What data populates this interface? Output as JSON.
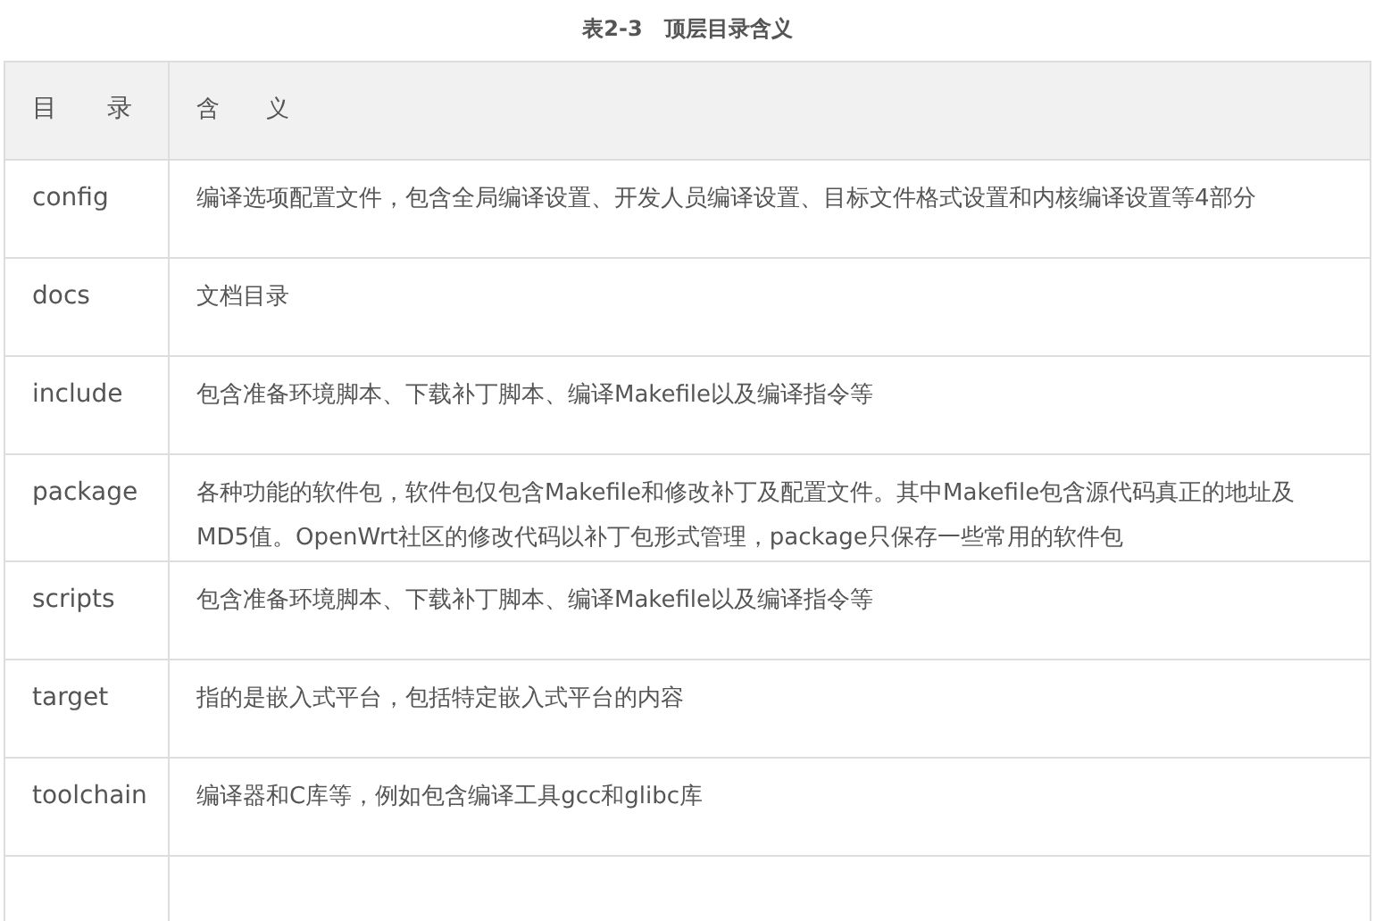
{
  "caption": "表2-3　顶层目录含义",
  "table": {
    "columns": [
      "目　　录",
      "含　　义"
    ],
    "rows": [
      {
        "name": "config",
        "meaning": "编译选项配置文件，包含全局编译设置、开发人员编译设置、目标文件格式设置和内核编译设置等4部分"
      },
      {
        "name": "docs",
        "meaning": "文档目录"
      },
      {
        "name": "include",
        "meaning": "包含准备环境脚本、下载补丁脚本、编译Makefile以及编译指令等"
      },
      {
        "name": "package",
        "meaning": "各种功能的软件包，软件包仅包含Makefile和修改补丁及配置文件。其中Makefile包含源代码真正的地址及MD5值。OpenWrt社区的修改代码以补丁包形式管理，package只保存一些常用的软件包"
      },
      {
        "name": "scripts",
        "meaning": "包含准备环境脚本、下载补丁脚本、编译Makefile以及编译指令等"
      },
      {
        "name": "target",
        "meaning": "指的是嵌入式平台，包括特定嵌入式平台的内容"
      },
      {
        "name": "toolchain",
        "meaning": "编译器和C库等，例如包含编译工具gcc和glibc库"
      }
    ]
  }
}
